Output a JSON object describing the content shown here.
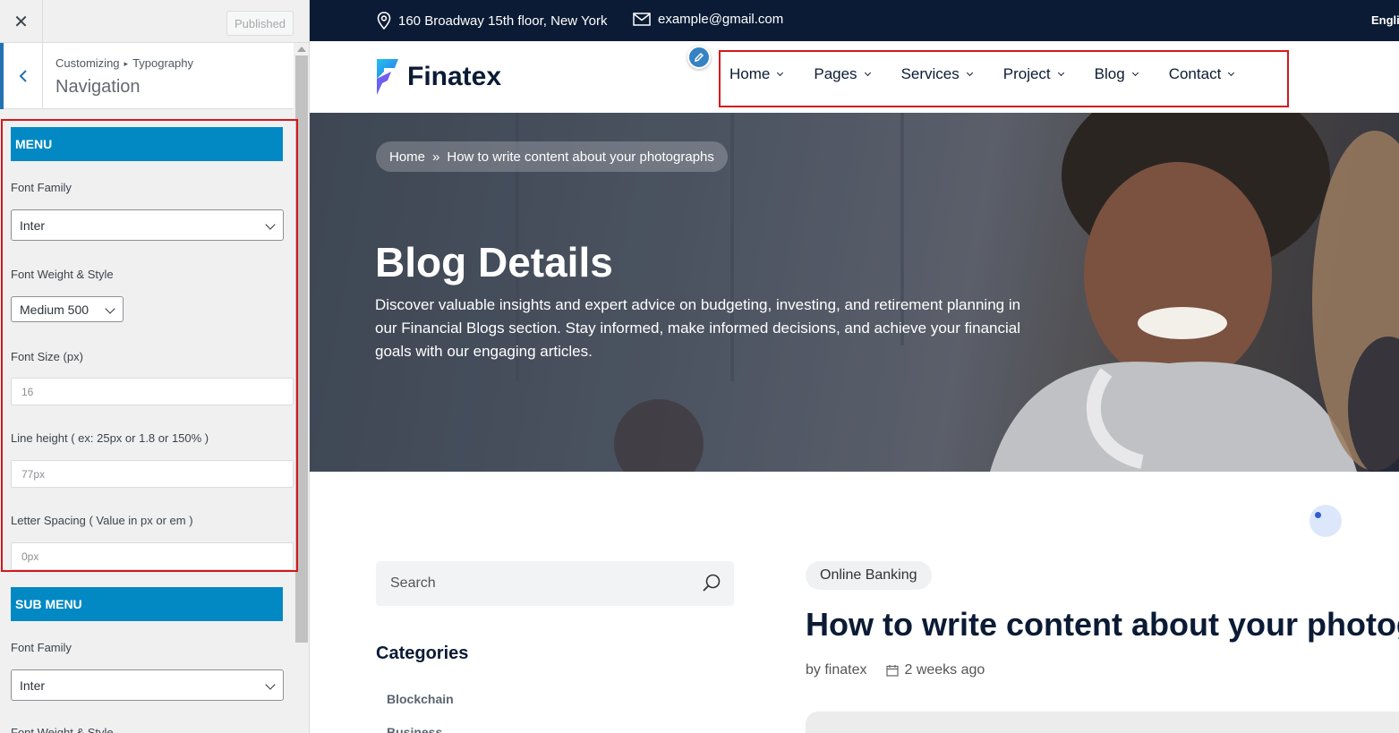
{
  "customizer": {
    "close_icon": "close-icon",
    "published_label": "Published",
    "breadcrumb": {
      "parent": "Customizing",
      "separator": "▸",
      "current": "Typography"
    },
    "section_title": "Navigation",
    "menu": {
      "heading": "MENU",
      "font_family_label": "Font Family",
      "font_family_value": "Inter",
      "font_weight_label": "Font Weight & Style",
      "font_weight_value": "Medium 500",
      "font_size_label": "Font Size (px)",
      "font_size_value": "16",
      "line_height_label": "Line height ( ex: 25px or 1.8 or 150% )",
      "line_height_value": "77px",
      "letter_spacing_label": "Letter Spacing ( Value in px or em )",
      "letter_spacing_value": "0px"
    },
    "sub_menu": {
      "heading": "SUB MENU",
      "font_family_label": "Font Family",
      "font_family_value": "Inter",
      "font_weight_label": "Font Weight & Style"
    }
  },
  "site": {
    "topbar": {
      "address": "160 Broadway 15th floor, New York",
      "email": "example@gmail.com",
      "language": "English"
    },
    "logo_text": "Finatex",
    "nav": [
      "Home",
      "Pages",
      "Services",
      "Project",
      "Blog",
      "Contact"
    ],
    "hero": {
      "breadcrumb_home": "Home",
      "breadcrumb_sep": "»",
      "breadcrumb_current": "How to write content about your photographs",
      "title": "Blog Details",
      "description": "Discover valuable insights and expert advice on budgeting, investing, and retirement planning in our Financial Blogs section. Stay informed, make informed decisions, and achieve your financial goals with our engaging articles."
    },
    "sidebar": {
      "search_placeholder": "Search",
      "categories_title": "Categories",
      "categories": [
        "Blockchain",
        "Business"
      ]
    },
    "post": {
      "tag": "Online Banking",
      "title": "How to write content about your photographs",
      "author": "by finatex",
      "date": "2 weeks ago"
    }
  },
  "colors": {
    "accent_blue": "#0289c4",
    "highlight_red": "#d4181c",
    "topbar_navy": "#0b1b35"
  }
}
